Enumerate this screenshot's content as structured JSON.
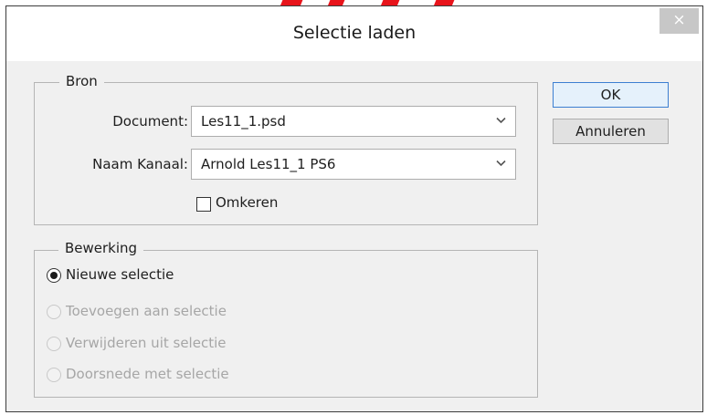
{
  "dialog": {
    "title": "Selectie laden",
    "close_glyph": "×"
  },
  "source_group": {
    "legend": "Bron",
    "document_label": "Document:",
    "document_value": "Les11_1.psd",
    "channel_label": "Naam Kanaal:",
    "channel_value": "Arnold Les11_1 PS6",
    "invert_label": "Omkeren",
    "invert_checked": false
  },
  "operation_group": {
    "legend": "Bewerking",
    "options": [
      {
        "label": "Nieuwe selectie",
        "checked": true,
        "enabled": true
      },
      {
        "label": "Toevoegen aan selectie",
        "checked": false,
        "enabled": false
      },
      {
        "label": "Verwijderen uit selectie",
        "checked": false,
        "enabled": false
      },
      {
        "label": "Doorsnede met selectie",
        "checked": false,
        "enabled": false
      }
    ]
  },
  "buttons": {
    "ok": "OK",
    "cancel": "Annuleren"
  },
  "icons": {
    "close": "close-icon",
    "dropdown": "chevron-down-icon"
  },
  "colors": {
    "dialog_background": "#f0f0f0",
    "default_button_border": "#3c7fd1",
    "disabled_text": "#a6a6a6",
    "close_button": "#c7c7c7"
  }
}
